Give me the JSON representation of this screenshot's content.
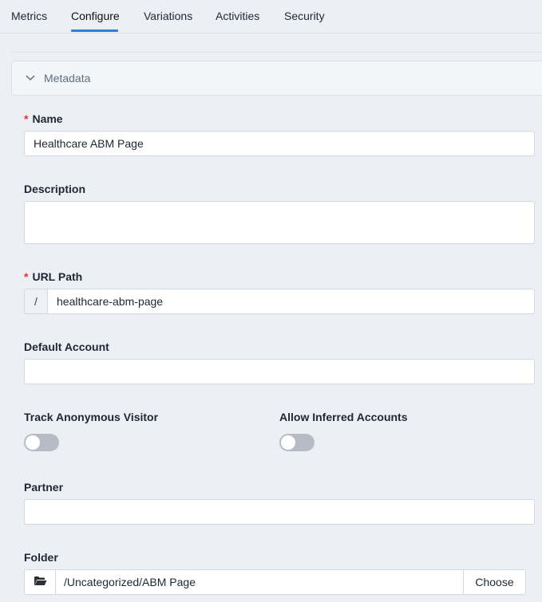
{
  "tabs": [
    {
      "label": "Metrics"
    },
    {
      "label": "Configure"
    },
    {
      "label": "Variations"
    },
    {
      "label": "Activities"
    },
    {
      "label": "Security"
    }
  ],
  "active_tab": "Configure",
  "metadata_section": {
    "title": "Metadata",
    "expanded": true
  },
  "required_marker": "*",
  "form": {
    "name": {
      "label": "Name",
      "required": true,
      "value": "Healthcare ABM Page"
    },
    "description": {
      "label": "Description",
      "value": ""
    },
    "url_path": {
      "label": "URL Path",
      "required": true,
      "prefix": "/",
      "value": "healthcare-abm-page"
    },
    "default_account": {
      "label": "Default Account",
      "value": ""
    },
    "track_anonymous_visitor": {
      "label": "Track Anonymous Visitor",
      "enabled": false
    },
    "allow_inferred_accounts": {
      "label": "Allow Inferred Accounts",
      "enabled": false
    },
    "partner": {
      "label": "Partner",
      "value": ""
    },
    "folder": {
      "label": "Folder",
      "value": "/Uncategorized/ABM Page",
      "choose_label": "Choose"
    }
  },
  "icons": {
    "chevron": "chevron-down-icon",
    "folder": "folder-open-icon"
  },
  "colors": {
    "accent": "#2f7fd6",
    "required": "#e0353b",
    "toggle_off": "#b7bcc4",
    "background": "#eceff4"
  }
}
